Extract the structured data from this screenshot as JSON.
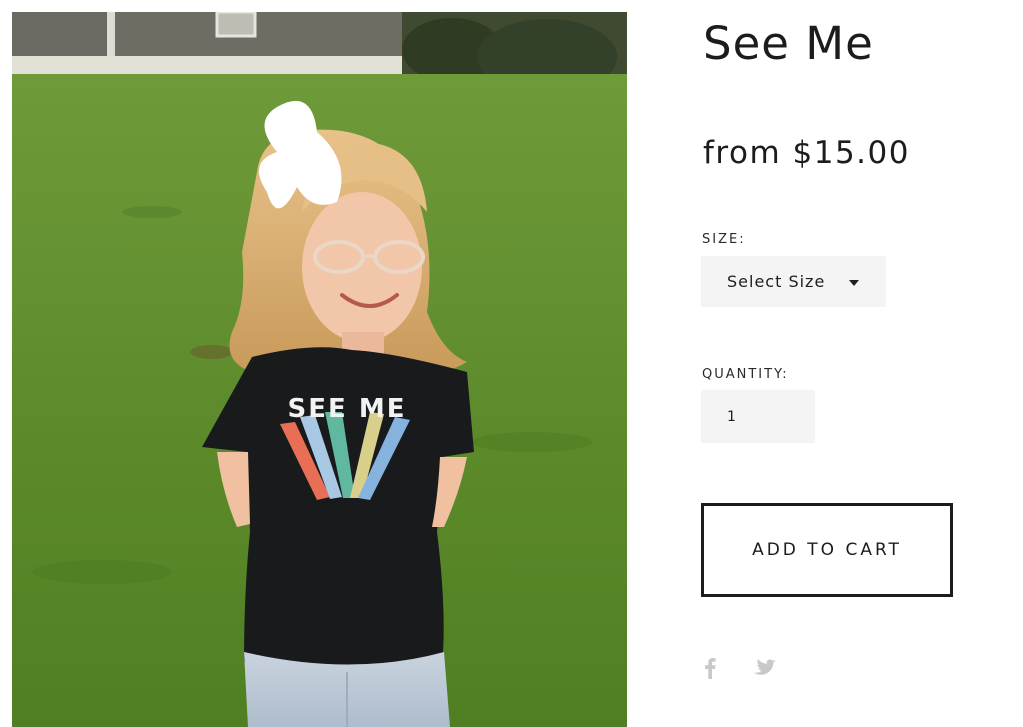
{
  "product": {
    "title": "See Me",
    "price": "from $15.00",
    "image_alt": "Child wearing black SEE ME rainbow t-shirt on grass",
    "shirt_print": "SEE ME"
  },
  "size": {
    "label": "SIZE:",
    "selected": "Select Size"
  },
  "quantity": {
    "label": "QUANTITY:",
    "value": "1"
  },
  "cart": {
    "button_label": "ADD TO CART"
  },
  "share": {
    "icons": [
      "facebook-icon",
      "twitter-icon"
    ],
    "icon_color": "#c9c9c9"
  },
  "colors": {
    "text": "#1c1c1c",
    "field_bg": "#f4f4f4",
    "button_border": "#1c1c1c"
  }
}
